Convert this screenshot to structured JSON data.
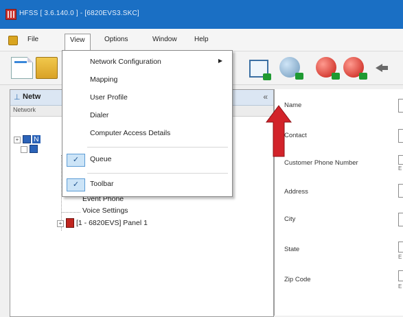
{
  "window": {
    "title": "HFSS [ 3.6.140.0 ] - [6820EVS3.SKC]"
  },
  "menubar": {
    "items": [
      "File",
      "View",
      "Options",
      "Window",
      "Help"
    ]
  },
  "toolbar": {
    "icons": [
      "new-document-icon",
      "open-folder-icon",
      "screen-download-icon",
      "globe-download-icon",
      "red-sphere-download-icon",
      "red-sphere-upload-icon",
      "arrow-left-icon"
    ]
  },
  "view_menu": {
    "items": [
      {
        "label": "Network Configuration",
        "submenu": "▶"
      },
      {
        "label": "Mapping"
      },
      {
        "label": "User Profile"
      },
      {
        "label": "Dialer"
      },
      {
        "label": "Computer Access Details"
      },
      {
        "label": "Queue",
        "checked": true,
        "check": "✓"
      },
      {
        "label": "Toolbar",
        "checked": true,
        "check": "✓"
      }
    ]
  },
  "left_panel": {
    "title": "Netw",
    "subheader": "Network",
    "close_glyph": "«",
    "tree": [
      {
        "label": "Event Phone"
      },
      {
        "label": "Voice Settings"
      },
      {
        "label": "[1 - 6820EVS] Panel 1"
      }
    ],
    "expander_glyph": "+",
    "node_label_partial": "N"
  },
  "right_panel": {
    "fields": [
      "Name",
      "Contact",
      "Customer Phone Number",
      "Address",
      "City",
      "State",
      "Zip Code"
    ],
    "sub_hint": "E"
  },
  "colors": {
    "titlebar": "#1a6fc4",
    "highlight": "#cce4f7",
    "annotation_arrow": "#d2232a"
  }
}
